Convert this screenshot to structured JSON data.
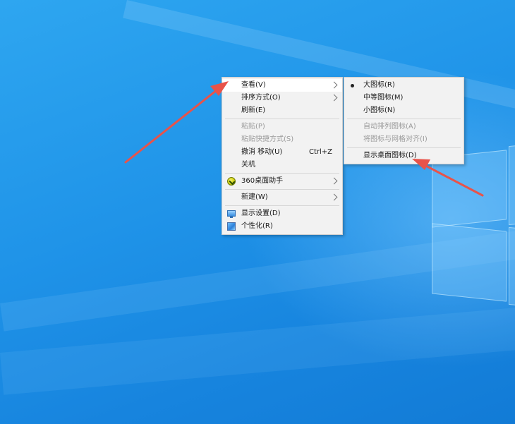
{
  "context_menu": {
    "items": [
      {
        "label": "查看(V)",
        "has_submenu": true,
        "state": "highlighted"
      },
      {
        "label": "排序方式(O)",
        "has_submenu": true
      },
      {
        "label": "刷新(E)"
      },
      {
        "label": "粘贴(P)",
        "state": "disabled"
      },
      {
        "label": "粘贴快捷方式(S)",
        "state": "disabled"
      },
      {
        "label": "撤消 移动(U)",
        "shortcut": "Ctrl+Z"
      },
      {
        "label": "关机"
      },
      {
        "label": "360桌面助手",
        "has_submenu": true,
        "icon": "360-assistant-icon"
      },
      {
        "label": "新建(W)",
        "has_submenu": true
      },
      {
        "label": "显示设置(D)",
        "icon": "display-settings-icon"
      },
      {
        "label": "个性化(R)",
        "icon": "personalize-icon"
      }
    ]
  },
  "view_submenu": {
    "items": [
      {
        "label": "大图标(R)",
        "selected": true
      },
      {
        "label": "中等图标(M)"
      },
      {
        "label": "小图标(N)"
      },
      {
        "label": "自动排列图标(A)",
        "state": "disabled"
      },
      {
        "label": "将图标与网格对齐(I)",
        "state": "disabled"
      },
      {
        "label": "显示桌面图标(D)",
        "state": "highlighted"
      }
    ]
  },
  "annotation_color": "#e8534a"
}
